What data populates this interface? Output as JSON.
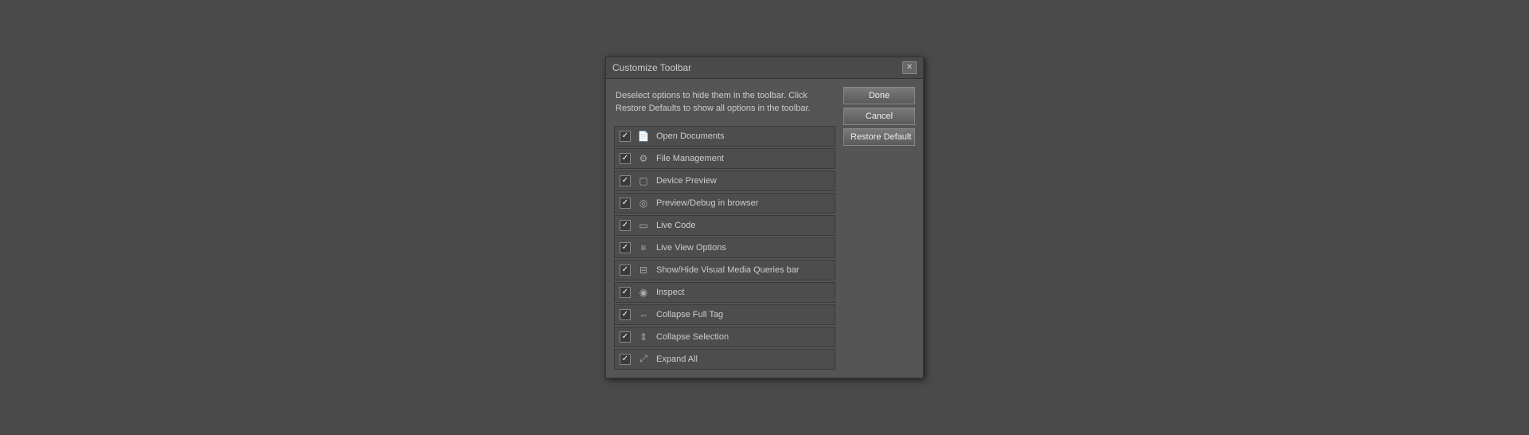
{
  "dialog": {
    "title": "Customize Toolbar",
    "description": "Deselect options to hide them in the toolbar. Click Restore Defaults to show all options in the toolbar.",
    "close_label": "✕",
    "buttons": {
      "done": "Done",
      "cancel": "Cancel",
      "restore": "Restore Default"
    },
    "items": [
      {
        "id": "open-docs",
        "label": "Open Documents",
        "checked": true,
        "icon": "docs"
      },
      {
        "id": "file-mgmt",
        "label": "File Management",
        "checked": true,
        "icon": "files"
      },
      {
        "id": "device-preview",
        "label": "Device Preview",
        "checked": true,
        "icon": "device"
      },
      {
        "id": "preview-debug",
        "label": "Preview/Debug in browser",
        "checked": true,
        "icon": "globe"
      },
      {
        "id": "live-code",
        "label": "Live Code",
        "checked": true,
        "icon": "code"
      },
      {
        "id": "live-view",
        "label": "Live View Options",
        "checked": true,
        "icon": "lines"
      },
      {
        "id": "show-hide-media",
        "label": "Show/Hide Visual Media Queries bar",
        "checked": true,
        "icon": "media"
      },
      {
        "id": "inspect",
        "label": "Inspect",
        "checked": true,
        "icon": "inspect"
      },
      {
        "id": "collapse-full",
        "label": "Collapse Full Tag",
        "checked": true,
        "icon": "collapse-full"
      },
      {
        "id": "collapse-sel",
        "label": "Collapse Selection",
        "checked": true,
        "icon": "collapse-sel"
      },
      {
        "id": "expand-all",
        "label": "Expand All",
        "checked": true,
        "icon": "expand"
      }
    ]
  }
}
